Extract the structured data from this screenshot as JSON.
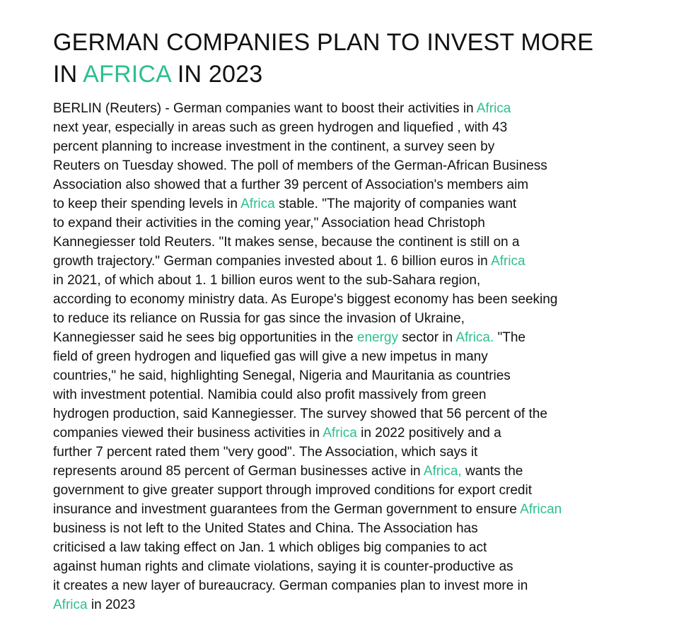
{
  "colors": {
    "accent": "#2dbf8f",
    "text": "#111111",
    "background": "#ffffff"
  },
  "headline": {
    "line1": "GERMAN COMPANIES PLAN TO INVEST MORE",
    "line2_pre": "IN ",
    "line2_accent": "AFRICA",
    "line2_post": " IN 2023"
  },
  "body_lines": [
    [
      {
        "t": "BERLIN (Reuters) - German companies want to boost their activities in "
      },
      {
        "t": "Africa",
        "a": true
      }
    ],
    [
      {
        "t": "next year, especially in areas such as green hydrogen and liquefied , with 43"
      }
    ],
    [
      {
        "t": "percent planning to increase investment in the continent, a survey seen by"
      }
    ],
    [
      {
        "t": "Reuters on Tuesday showed. The poll of members of the German-African Business"
      }
    ],
    [
      {
        "t": "Association also showed that a further 39 percent of Association's members aim"
      }
    ],
    [
      {
        "t": "to keep their spending levels in "
      },
      {
        "t": "Africa",
        "a": true
      },
      {
        "t": " stable. \"The majority of companies want"
      }
    ],
    [
      {
        "t": "to expand their activities in the coming year,\" Association head Christoph"
      }
    ],
    [
      {
        "t": "Kannegiesser told Reuters. \"It makes sense, because the continent is still on a"
      }
    ],
    [
      {
        "t": "growth trajectory.\" German companies invested about 1. 6 billion euros in "
      },
      {
        "t": "Africa",
        "a": true
      }
    ],
    [
      {
        "t": "in 2021, of which about 1. 1 billion euros went to the sub-Sahara region,"
      }
    ],
    [
      {
        "t": "according to economy ministry data. As Europe's biggest economy has been seeking"
      }
    ],
    [
      {
        "t": "to reduce its reliance on Russia for gas since the invasion of Ukraine,"
      }
    ],
    [
      {
        "t": "Kannegiesser said he sees big opportunities in the "
      },
      {
        "t": "energy",
        "a": true
      },
      {
        "t": " sector in "
      },
      {
        "t": "Africa.",
        "a": true
      },
      {
        "t": " \"The"
      }
    ],
    [
      {
        "t": "field of green hydrogen and liquefied gas will give a new impetus in many"
      }
    ],
    [
      {
        "t": "countries,\" he said, highlighting Senegal, Nigeria and Mauritania as countries"
      }
    ],
    [
      {
        "t": "with investment potential. Namibia could also profit massively from green"
      }
    ],
    [
      {
        "t": "hydrogen production, said Kannegiesser. The survey showed that 56 percent of the"
      }
    ],
    [
      {
        "t": "companies viewed their business activities in "
      },
      {
        "t": "Africa",
        "a": true
      },
      {
        "t": " in 2022 positively and a"
      }
    ],
    [
      {
        "t": "further 7 percent rated them \"very good\". The Association, which says it"
      }
    ],
    [
      {
        "t": "represents around 85 percent of German businesses active in "
      },
      {
        "t": "Africa,",
        "a": true
      },
      {
        "t": " wants the"
      }
    ],
    [
      {
        "t": "government to give greater support through improved conditions for export credit"
      }
    ],
    [
      {
        "t": "insurance and investment guarantees from the German government to ensure "
      },
      {
        "t": "African",
        "a": true
      }
    ],
    [
      {
        "t": "business is not left to the United States and China. The Association has"
      }
    ],
    [
      {
        "t": "criticised a law taking effect on Jan. 1 which obliges big companies to act"
      }
    ],
    [
      {
        "t": "against human rights and climate violations, saying it is counter-productive as"
      }
    ],
    [
      {
        "t": "it creates a new layer of bureaucracy. German companies plan to invest more in"
      }
    ],
    [
      {
        "t": "Africa",
        "a": true
      },
      {
        "t": " in 2023"
      }
    ]
  ]
}
